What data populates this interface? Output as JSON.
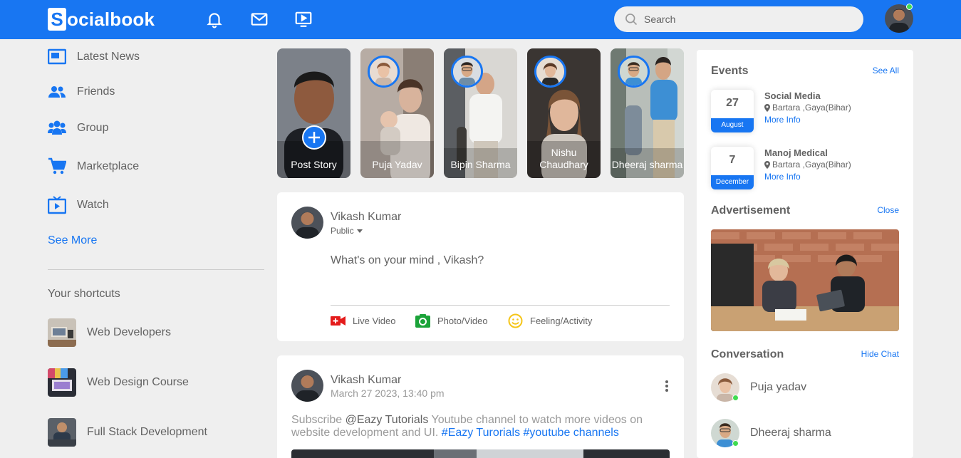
{
  "brand": {
    "logo_letter": "S",
    "logo_rest": "ocialbook"
  },
  "navbar": {
    "icons": [
      "bell-icon",
      "mail-icon",
      "video-icon"
    ],
    "search_placeholder": "Search",
    "accent": "#1876f2"
  },
  "sidebar": {
    "items": [
      {
        "label": "Latest News",
        "icon": "news-icon"
      },
      {
        "label": "Friends",
        "icon": "friends-icon"
      },
      {
        "label": "Group",
        "icon": "group-icon"
      },
      {
        "label": "Marketplace",
        "icon": "cart-icon"
      },
      {
        "label": "Watch",
        "icon": "watch-icon"
      }
    ],
    "see_more": "See More",
    "shortcuts_title": "Your shortcuts",
    "shortcuts": [
      {
        "label": "Web Developers"
      },
      {
        "label": "Web Design Course"
      },
      {
        "label": "Full Stack Development"
      }
    ]
  },
  "stories": [
    {
      "label": "Post Story"
    },
    {
      "label": "Puja Yadav"
    },
    {
      "label": "Bipin Sharma"
    },
    {
      "label": "Nishu Chaudhary"
    },
    {
      "label": "Dheeraj sharma"
    }
  ],
  "write_post": {
    "user": "Vikash Kumar",
    "privacy": "Public",
    "placeholder": "What's on your mind , Vikash?",
    "actions": [
      {
        "label": "Live Video",
        "icon": "live-video-icon",
        "color": "#e41b1b"
      },
      {
        "label": "Photo/Video",
        "icon": "photo-icon",
        "color": "#1ba339"
      },
      {
        "label": "Feeling/Activity",
        "icon": "smile-icon",
        "color": "#f5c518"
      }
    ]
  },
  "post": {
    "user": "Vikash Kumar",
    "date": "March 27 2023, 13:40 pm",
    "text_before": "Subscribe ",
    "mention": "@Eazy Tutorials",
    "text_after": " Youtube channel to watch more videos on website development and UI. ",
    "hashtags": "#Eazy Turorials #youtube channels"
  },
  "events": {
    "title": "Events",
    "see_all": "See All",
    "items": [
      {
        "day": "27",
        "month": "August",
        "name": "Social Media",
        "location": "Bartara ,Gaya(Bihar)",
        "more": "More Info"
      },
      {
        "day": "7",
        "month": "December",
        "name": "Manoj Medical",
        "location": "Bartara ,Gaya(Bihar)",
        "more": "More Info"
      }
    ]
  },
  "advertisement": {
    "title": "Advertisement",
    "close": "Close"
  },
  "conversation": {
    "title": "Conversation",
    "hide": "Hide Chat",
    "items": [
      {
        "name": "Puja yadav"
      },
      {
        "name": "Dheeraj sharma"
      }
    ]
  }
}
